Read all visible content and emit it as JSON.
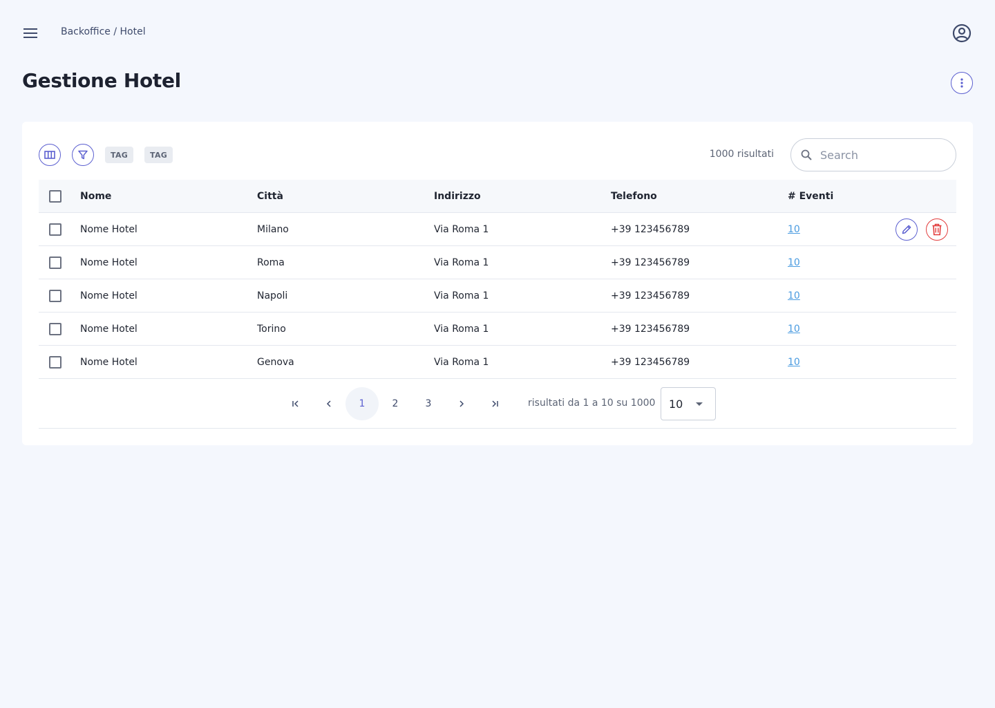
{
  "header": {
    "breadcrumb": "Backoffice / Hotel",
    "title": "Gestione Hotel"
  },
  "toolbar": {
    "tags": [
      "TAG",
      "TAG"
    ],
    "result_count": "1000 risultati",
    "search_placeholder": "Search"
  },
  "table": {
    "columns": [
      "Nome",
      "Città",
      "Indirizzo",
      "Telefono",
      "# Eventi"
    ],
    "rows": [
      {
        "nome": "Nome Hotel",
        "citta": "Milano",
        "indirizzo": "Via Roma 1",
        "telefono": "+39 123456789",
        "eventi": "10"
      },
      {
        "nome": "Nome Hotel",
        "citta": "Roma",
        "indirizzo": "Via Roma 1",
        "telefono": "+39 123456789",
        "eventi": "10"
      },
      {
        "nome": "Nome Hotel",
        "citta": "Napoli",
        "indirizzo": "Via Roma 1",
        "telefono": "+39 123456789",
        "eventi": "10"
      },
      {
        "nome": "Nome Hotel",
        "citta": "Torino",
        "indirizzo": "Via Roma 1",
        "telefono": "+39 123456789",
        "eventi": "10"
      },
      {
        "nome": "Nome Hotel",
        "citta": "Genova",
        "indirizzo": "Via Roma 1",
        "telefono": "+39 123456789",
        "eventi": "10"
      }
    ]
  },
  "pagination": {
    "pages": [
      "1",
      "2",
      "3"
    ],
    "active_page": "1",
    "info": "risultati da 1 a 10 su 1000",
    "page_size": "10"
  },
  "icons": {
    "menu": "menu-icon",
    "account": "account-circle-icon",
    "more": "more-vertical-icon",
    "columns": "columns-icon",
    "filter": "filter-icon",
    "search": "search-icon",
    "edit": "pencil-icon",
    "delete": "trash-icon"
  },
  "colors": {
    "background": "#f4f7fd",
    "accent": "#5b5fd0",
    "danger": "#e23b3b",
    "link": "#4a9be0"
  }
}
